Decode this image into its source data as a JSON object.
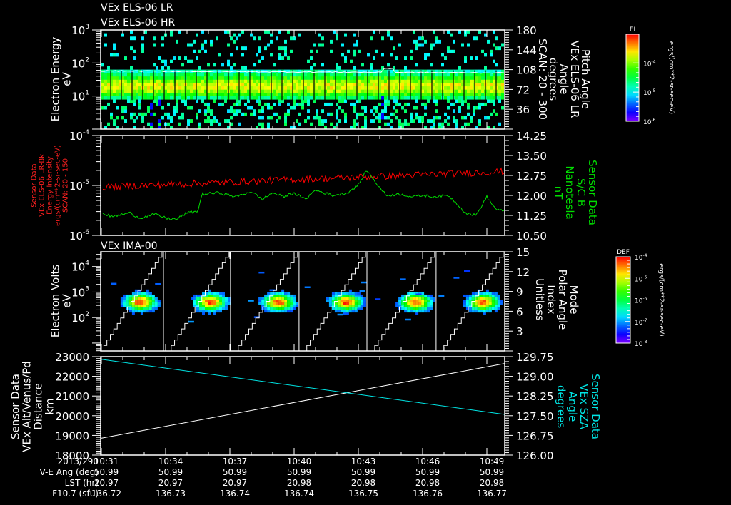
{
  "colors": {
    "background": "#000000",
    "axes": "#ffffff",
    "b_total_red": "#ff0000",
    "b_green": "#00dd00",
    "sza_cyan": "#00e5e5"
  },
  "chart_data": [
    {
      "type": "heatmap",
      "titles": [
        "VEx ELS-06 LR",
        "VEx ELS-06 HR"
      ],
      "ylabel": [
        "Electron Energy",
        "eV"
      ],
      "yscale": "log",
      "ylim": [
        1,
        1000
      ],
      "yticks": [
        {
          "base": "10",
          "exp": "3"
        },
        {
          "base": "10",
          "exp": "2"
        },
        {
          "base": "10",
          "exp": "1"
        }
      ],
      "y2label": [
        "Pitch Angle",
        "VEx ELS-06 LR",
        "Angle",
        "degrees",
        "SCAN: 20 - 300"
      ],
      "y2lim": [
        0,
        180
      ],
      "y2ticks": [
        "180",
        "144",
        "108",
        "72",
        "36"
      ],
      "colorbar": {
        "title": "EI",
        "label": "ergs/(cm**2-sr-sec-eV)",
        "scale": "log",
        "ticks": [
          {
            "base": "10",
            "exp": "-4"
          },
          {
            "base": "10",
            "exp": "-5"
          },
          {
            "base": "10",
            "exp": "-6"
          }
        ]
      },
      "description_values": {
        "peak_energy_eV": 20,
        "band_eV": [
          8,
          55
        ],
        "overlay_line_eV": 56
      }
    },
    {
      "type": "line",
      "ylabel": [
        "Sensor Data",
        "VEx ELS-06 LR-Bk",
        "Energy Intensity",
        "ergs/(cm**2-sr-sec-eV)",
        "SCAN: 20 - 150"
      ],
      "yscale": "log",
      "ylim": [
        1e-06,
        0.0001
      ],
      "yticks": [
        {
          "base": "10",
          "exp": "-4"
        },
        {
          "base": "10",
          "exp": "-5"
        },
        {
          "base": "10",
          "exp": "-6"
        }
      ],
      "y2label": [
        "Sensor Data",
        "S/C B",
        "Nanotesla",
        "nT"
      ],
      "y2lim": [
        10.5,
        14.25
      ],
      "y2ticks": [
        "14.25",
        "13.50",
        "12.75",
        "12.00",
        "11.25",
        "10.50"
      ],
      "series": [
        {
          "axis": "left",
          "color": "#ff0000",
          "x_min": [
            31,
            49.83
          ],
          "values": [
            9.3e-06,
            1.9e-05
          ]
        },
        {
          "axis": "right",
          "color": "#00dd00",
          "x_min": [
            31.0,
            31.5,
            32.3,
            32.8,
            33.5,
            34.0,
            34.5,
            35.0,
            35.5,
            35.7,
            36.5,
            37.3,
            38.0,
            38.5,
            39.0,
            39.5,
            40.0,
            40.5,
            41.0,
            41.8,
            42.5,
            43.0,
            43.4,
            43.8,
            44.3,
            45.0,
            45.5,
            46.0,
            46.5,
            47.2,
            47.6,
            48.0,
            48.5,
            49.0,
            49.4,
            49.8
          ],
          "values": [
            11.35,
            11.2,
            11.35,
            11.15,
            11.3,
            11.15,
            11.1,
            11.35,
            11.4,
            12.05,
            12.1,
            11.95,
            12.15,
            11.85,
            12.1,
            11.95,
            12.1,
            11.85,
            12.2,
            12.0,
            12.1,
            12.4,
            12.95,
            12.5,
            12.0,
            12.05,
            11.95,
            12.0,
            11.95,
            12.0,
            11.7,
            11.35,
            11.25,
            11.95,
            11.5,
            11.4
          ]
        }
      ]
    },
    {
      "type": "heatmap",
      "title": "VEx IMA-00",
      "ylabel": [
        "Electron Volts",
        "eV"
      ],
      "yscale": "log",
      "yticks": [
        {
          "base": "10",
          "exp": "4"
        },
        {
          "base": "10",
          "exp": "3"
        },
        {
          "base": "10",
          "exp": "2"
        }
      ],
      "y2label": [
        "Mode",
        "Polar Angle",
        "Index",
        "Unitless"
      ],
      "y2lim": [
        0,
        15
      ],
      "y2ticks": [
        "15",
        "12",
        "9",
        "6",
        "3"
      ],
      "colorbar": {
        "title": "DEF",
        "label": "ergs/(cm**2-sr-sec-eV)",
        "scale": "log",
        "ticks": [
          {
            "base": "10",
            "exp": "-4"
          },
          {
            "base": "10",
            "exp": "-5"
          },
          {
            "base": "10",
            "exp": "-6"
          },
          {
            "base": "10",
            "exp": "-7"
          },
          {
            "base": "10",
            "exp": "-8"
          }
        ]
      },
      "blob_center_times_min": [
        32.83,
        36.1,
        39.27,
        42.43,
        45.67,
        48.83
      ],
      "blob_peak_energy_eV": 400,
      "mode_switch_times_min": [
        33.9,
        37.03,
        40.23,
        43.4,
        46.63
      ]
    },
    {
      "type": "line",
      "ylabel": [
        "Sensor Data",
        "VEx Alt/Venus/Pd",
        "Distance",
        "km"
      ],
      "ylim": [
        18000,
        23000
      ],
      "yticks": [
        "23000",
        "22000",
        "21000",
        "20000",
        "19000",
        "18000"
      ],
      "y2label": [
        "Sensor Data",
        "VEx SZA",
        "Angle",
        "degrees"
      ],
      "y2lim": [
        126.0,
        129.75
      ],
      "y2ticks": [
        "129.75",
        "129.00",
        "128.25",
        "127.50",
        "126.75",
        "126.00"
      ],
      "series": [
        {
          "axis": "left",
          "color": "#ffffff",
          "x_min": [
            31,
            49.83
          ],
          "values": [
            18850,
            22650
          ]
        },
        {
          "axis": "right",
          "color": "#00e5e5",
          "x_min": [
            31,
            49.83
          ],
          "values": [
            129.65,
            127.55
          ]
        }
      ]
    }
  ],
  "time_axis": {
    "row_labels": [
      "2013/290",
      "V-E Ang (deg)",
      "LST (hr)",
      "F10.7 (sfu)"
    ],
    "columns": [
      {
        "time": "10:31",
        "ve_ang": "50.99",
        "lst": "20.97",
        "f107": "136.72"
      },
      {
        "time": "10:34",
        "ve_ang": "50.99",
        "lst": "20.97",
        "f107": "136.73"
      },
      {
        "time": "10:37",
        "ve_ang": "50.99",
        "lst": "20.97",
        "f107": "136.74"
      },
      {
        "time": "10:40",
        "ve_ang": "50.99",
        "lst": "20.98",
        "f107": "136.74"
      },
      {
        "time": "10:43",
        "ve_ang": "50.99",
        "lst": "20.98",
        "f107": "136.75"
      },
      {
        "time": "10:46",
        "ve_ang": "50.99",
        "lst": "20.98",
        "f107": "136.76"
      },
      {
        "time": "10:49",
        "ve_ang": "50.99",
        "lst": "20.98",
        "f107": "136.77"
      }
    ]
  }
}
